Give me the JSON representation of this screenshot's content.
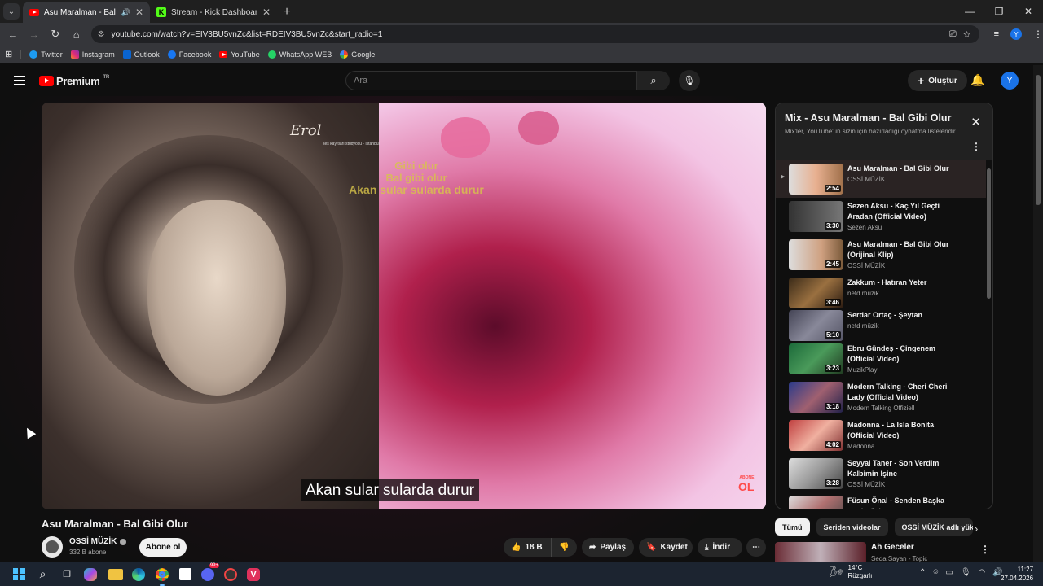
{
  "browser": {
    "tabs": [
      {
        "title": "Asu Maralman - Bal Gibi Ol",
        "active": true,
        "audio": "🔊"
      },
      {
        "title": "Stream - Kick Dashboard",
        "active": false,
        "favicon": "K"
      }
    ],
    "url": "youtube.com/watch?v=EIV3BU5vnZc&list=RDEIV3BU5vnZc&start_radio=1",
    "profile_initial": "Y",
    "bookmarks": [
      "Twitter",
      "Instagram",
      "Outlook",
      "Facebook",
      "YouTube",
      "WhatsApp WEB",
      "Google"
    ]
  },
  "youtube": {
    "logo": "Premium",
    "region": "TR",
    "search_placeholder": "Ara",
    "create_label": "Oluştur",
    "avatar_initial": "Y"
  },
  "video": {
    "subtitle": "Akan sular sularda durur",
    "overlay_lyrics": [
      "Gibi olur",
      "Bal gibi olur",
      "Akan sular sularda durur"
    ],
    "overlay_brand": "Erol",
    "overlay_brand_sub": "ses kayıtları stüdyosu · istanbul",
    "abone_small": "ABONE",
    "abone_big": "OL",
    "title": "Asu Maralman - Bal Gibi Olur",
    "channel": "OSSİ MÜZİK",
    "subscribers": "332 B abone",
    "subscribe_label": "Abone ol",
    "likes": "18 B",
    "share_label": "Paylaş",
    "save_label": "Kaydet",
    "download_label": "İndir"
  },
  "playlist": {
    "title": "Mix - Asu Maralman - Bal Gibi Olur",
    "subtitle": "Mix'ler, YouTube'un sizin için hazırladığı oynatma listeleridir",
    "items": [
      {
        "title": "Asu Maralman - Bal Gibi Olur",
        "channel": "OSSİ MÜZİK",
        "duration": "2:54",
        "current": true,
        "indicator": "▶"
      },
      {
        "title": "Sezen Aksu - Kaç Yıl Geçti Aradan (Official Video)",
        "channel": "Sezen Aksu",
        "duration": "3:30"
      },
      {
        "title": "Asu Maralman - Bal Gibi Olur (Orijinal Klip)",
        "channel": "OSSİ MÜZİK",
        "duration": "2:45"
      },
      {
        "title": "Zakkum - Hatıran Yeter",
        "channel": "netd müzik",
        "duration": "3:46"
      },
      {
        "title": "Serdar Ortaç - Şeytan",
        "channel": "netd müzik",
        "duration": "5:10"
      },
      {
        "title": "Ebru Gündeş - Çingenem (Official Video)",
        "channel": "MuzikPlay",
        "duration": "3:23"
      },
      {
        "title": "Modern Talking - Cheri Cheri Lady (Official Video)",
        "channel": "Modern Talking Offiziell",
        "duration": "3:18"
      },
      {
        "title": "Madonna - La Isla Bonita (Official Video)",
        "channel": "Madonna",
        "duration": "4:02"
      },
      {
        "title": "Seyyal Taner - Son Verdim Kalbimin İşine",
        "channel": "OSSİ MÜZİK",
        "duration": "3:28"
      },
      {
        "title": "Füsun Önal - Senden Başka",
        "channel": "OSSİ MÜZİK",
        "duration": ""
      }
    ]
  },
  "chips": [
    "Tümü",
    "Seriden videolar",
    "OSSİ MÜZİK adlı yükl"
  ],
  "recommendation": {
    "title": "Ah Geceler",
    "channel": "Seda Sayan - Topic"
  },
  "taskbar": {
    "weather_temp": "14°C",
    "weather_desc": "Rüzgarlı",
    "time": "11:27",
    "date": "27.04.2026",
    "badge_discord": "99+"
  }
}
